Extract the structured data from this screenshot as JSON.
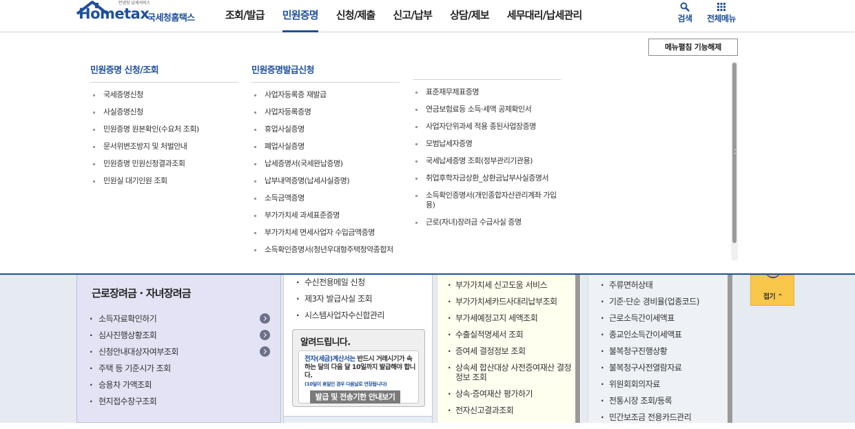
{
  "header": {
    "logo_tagline": "안녕맛 납세서비스",
    "logo_word": "Hometax",
    "logo_korean": "국세청홈택스",
    "nav": [
      "조회/발급",
      "민원증명",
      "신청/제출",
      "신고/납부",
      "상담/제보",
      "세무대리/납세관리"
    ],
    "active_nav": "민원증명",
    "search_label": "검색",
    "allmenu_label": "전체메뉴"
  },
  "mega": {
    "toggle_button": "메뉴펼침 기능해제",
    "columns": [
      {
        "title": "민원증명 신청/조회",
        "items": [
          "국세증명신청",
          "사실증명신청",
          "민원증명 원본확인(수요처 조회)",
          "문서위변조방지 및 처벌안내",
          "민원증명 민원신청결과조회",
          "민원실 대기인원 조회"
        ]
      },
      {
        "title": "민원증명발급신청",
        "items": [
          "사업자등록증 재발급",
          "사업자등록증명",
          "휴업사실증명",
          "폐업사실증명",
          "납세증명서(국세완납증명)",
          "납부내역증명(납세사실증명)",
          "소득금액증명",
          "부가가치세 과세표준증명",
          "부가가치세 면세사업자 수입금액증명",
          "소득확인증명서(청년우대형주택청약종합저축 가입 및 과세특례 신청용)"
        ]
      },
      {
        "title": "",
        "items": [
          "표준재무제표증명",
          "연금보험료등 소득·세액 공제확인서",
          "사업자단위과세 적용 종된사업장증명",
          "모범납세자증명",
          "국세납세증명 조회(정부관리기관용)",
          "취업후학자금상환_상환금납부사실증명서",
          "소득확인증명서(개인종합자산관리계좌 가입용)",
          "근로(자녀)장려금 수급사실 증명"
        ]
      }
    ]
  },
  "background": {
    "panel1": {
      "title": "근로장려금 · 자녀장려금",
      "items": [
        {
          "label": "소득자료확인하기",
          "go": true
        },
        {
          "label": "심사진행상황조회",
          "go": true
        },
        {
          "label": "신청안내대상자여부조회",
          "go": true
        },
        {
          "label": "주택 등 기준시가 조회",
          "go": false
        },
        {
          "label": "승용차 가액조회",
          "go": false
        },
        {
          "label": "현지접수창구조회",
          "go": false
        }
      ]
    },
    "panel2": {
      "items": [
        "수신전용메일 신청",
        "제3자 발급사실 조회",
        "시스템사업자수신합관리"
      ],
      "notice_title": "알려드립니다.",
      "notice_msg_hl": "전자(세금)계산서는",
      "notice_msg": " 반드시 거래시기가 속하는 달의 다음 달 10일까지 발급해야 합니다.",
      "notice_sub": "(10일이 휴일인 경우 다음날로 연장됩니다)",
      "notice_button": "발급 및 전송기한 안내보기"
    },
    "panel3": {
      "items": [
        "부가가치세 신고도움 서비스",
        "부가가치세카드사대리납부조회",
        "부가세예정고지 세액조회",
        "수출실적명세서 조회",
        "증여세 결정정보 조회",
        "상속세 합산대상 사전증여재산 결정정보 조회",
        "상속·증여재산 평가하기",
        "전자신고결과조회"
      ]
    },
    "panel4": {
      "items": [
        "주류면허상태",
        "기준·단순 경비율(업종코드)",
        "근로소득간이세액표",
        "종교인소득간이세액표",
        "불복청구진행상황",
        "불복청구사전열람자료",
        "위원회회의자료",
        "전통시장 조회/등록",
        "민간보조금 전용카드관리"
      ]
    },
    "fold_label": "접기",
    "colors": {
      "brand": "#1e4f9c",
      "fold": "#f9c74a"
    }
  }
}
